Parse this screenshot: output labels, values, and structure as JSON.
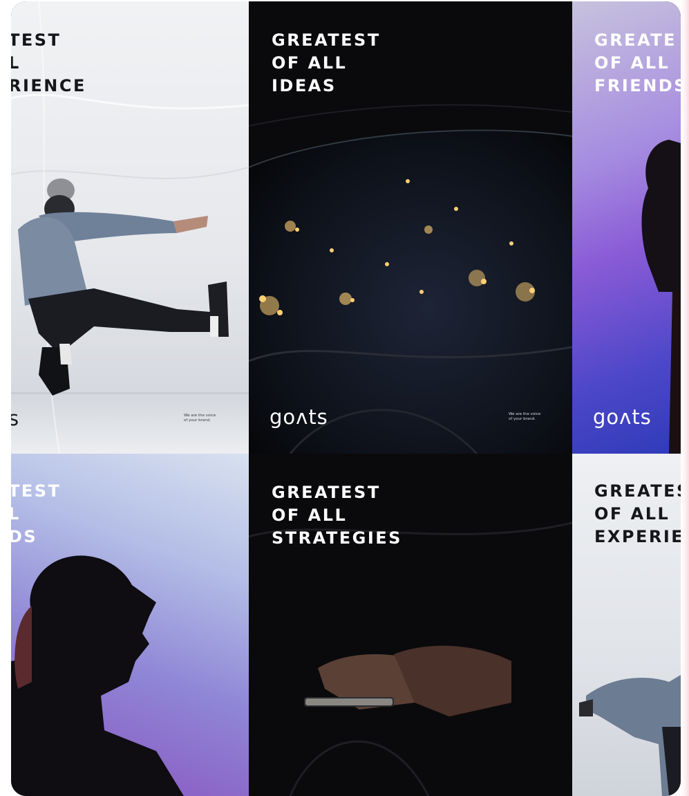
{
  "posters": [
    {
      "id": "p1",
      "headline": "TEST\nL\nRIENCE",
      "logo": "s",
      "tagline": "We are the voice\nof your brand."
    },
    {
      "id": "p2",
      "headline": "GREATEST\nOF ALL\nIDEAS",
      "logo": "goʌts",
      "tagline": "We are the voice\nof your brand."
    },
    {
      "id": "p3",
      "headline": "GREATE\nOF ALL\nFRIENDS",
      "logo": "goʌts"
    },
    {
      "id": "p4",
      "headline": "TEST\nL\nDS"
    },
    {
      "id": "p5",
      "headline": "GREATEST\nOF ALL\nSTRATEGIES"
    },
    {
      "id": "p6",
      "headline": "GREATES\nOF ALL\nEXPERIE"
    }
  ],
  "colors": {
    "dark_poster": "#0c0c10",
    "light_poster": "#e9ebef",
    "gradient_purple": "#8a5bd6",
    "gradient_blue": "#3b46c8",
    "city_lights": "#ffcf73"
  }
}
